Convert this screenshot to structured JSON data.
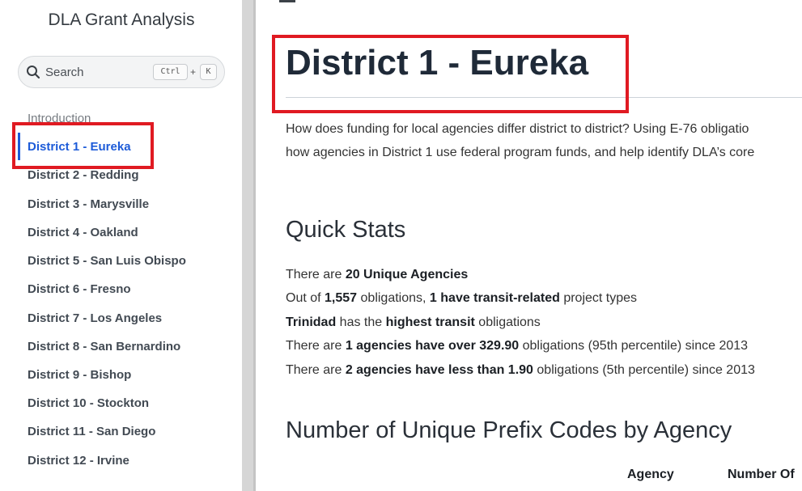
{
  "sidebar": {
    "site_title": "DLA Grant Analysis",
    "search": {
      "placeholder": "Search",
      "shortcut_ctrl": "Ctrl",
      "shortcut_plus": "+",
      "shortcut_key": "K"
    },
    "nav": {
      "intro": "Introduction",
      "items": [
        {
          "label": "District 1 - Eureka",
          "active": true
        },
        {
          "label": "District 2 - Redding"
        },
        {
          "label": "District 3 - Marysville"
        },
        {
          "label": "District 4 - Oakland"
        },
        {
          "label": "District 5 - San Luis Obispo"
        },
        {
          "label": "District 6 - Fresno"
        },
        {
          "label": "District 7 - Los Angeles"
        },
        {
          "label": "District 8 - San Bernardino"
        },
        {
          "label": "District 9 - Bishop"
        },
        {
          "label": "District 10 - Stockton"
        },
        {
          "label": "District 11 - San Diego"
        },
        {
          "label": "District 12 - Irvine"
        }
      ]
    }
  },
  "main": {
    "title": "District 1 - Eureka",
    "intro_line1": "How does funding for local agencies differ district to district? Using E-76 obligatio",
    "intro_line2": "how agencies in District 1 use federal program funds, and help identify DLA’s core",
    "quick_stats": {
      "heading": "Quick Stats",
      "line1": {
        "a": "There are ",
        "b": "20 Unique Agencies",
        "c": ""
      },
      "line2": {
        "a": "Out of ",
        "b": "1,557",
        "c": " obligations, ",
        "d": "1 have transit-related",
        "e": " project types"
      },
      "line3": {
        "a": "Trinidad",
        "b": " has the ",
        "c": "highest transit",
        "d": " obligations"
      },
      "line4": {
        "a": "There are ",
        "b": "1 agencies have over 329.90",
        "c": " obligations (95th percentile) since 2013"
      },
      "line5": {
        "a": "There are ",
        "b": "2 agencies have less than 1.90",
        "c": " obligations (5th percentile) since 2013"
      }
    },
    "prefix_section": {
      "heading": "Number of Unique Prefix Codes by Agency",
      "table_headers": [
        "Agency",
        "Number Of"
      ]
    }
  },
  "colors": {
    "accent": "#1d5bd8",
    "highlight_box": "#e01a22",
    "title_text": "#1f2a38"
  },
  "icons": {
    "search": "search-icon",
    "menu": "hamburger-menu-icon"
  }
}
